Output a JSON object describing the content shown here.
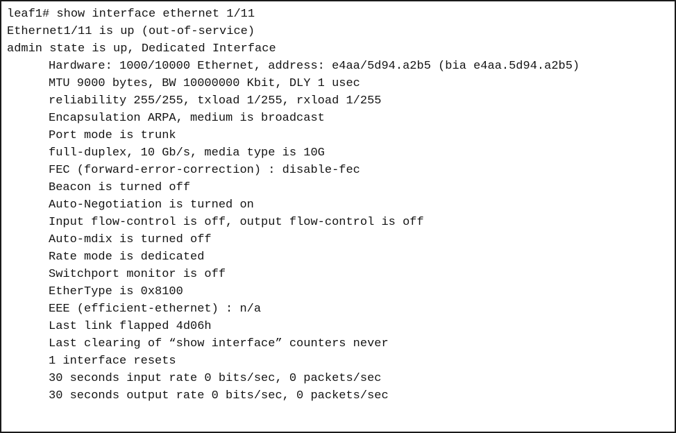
{
  "terminal": {
    "prompt_line": "leaf1# show interface ethernet 1/11",
    "command": "show interface ethernet 1/11",
    "hostname_prompt": "leaf1#",
    "interface": "Ethernet1/11",
    "colors": {
      "background": "#ffffff",
      "text": "#141414",
      "border": "#1a1a1a"
    },
    "lines": [
      {
        "text": "leaf1# show interface ethernet 1/11",
        "indent": false
      },
      {
        "text": "Ethernet1/11 is up (out-of-service)",
        "indent": false
      },
      {
        "text": "admin state is up, Dedicated Interface",
        "indent": false
      },
      {
        "text": "Hardware: 1000/10000 Ethernet, address: e4aa/5d94.a2b5 (bia e4aa.5d94.a2b5)",
        "indent": true
      },
      {
        "text": "MTU 9000 bytes, BW 10000000 Kbit, DLY 1 usec",
        "indent": true
      },
      {
        "text": "reliability 255/255, txload 1/255, rxload 1/255",
        "indent": true
      },
      {
        "text": "Encapsulation ARPA, medium is broadcast",
        "indent": true
      },
      {
        "text": "Port mode is trunk",
        "indent": true
      },
      {
        "text": "full-duplex, 10 Gb/s, media type is 10G",
        "indent": true
      },
      {
        "text": "FEC (forward-error-correction) : disable-fec",
        "indent": true
      },
      {
        "text": "Beacon is turned off",
        "indent": true
      },
      {
        "text": "Auto-Negotiation is turned on",
        "indent": true
      },
      {
        "text": "Input flow-control is off, output flow-control is off",
        "indent": true
      },
      {
        "text": "Auto-mdix is turned off",
        "indent": true
      },
      {
        "text": "Rate mode is dedicated",
        "indent": true
      },
      {
        "text": "Switchport monitor is off",
        "indent": true
      },
      {
        "text": "EtherType is 0x8100",
        "indent": true
      },
      {
        "text": "EEE (efficient-ethernet) : n/a",
        "indent": true
      },
      {
        "text": "Last link flapped 4d06h",
        "indent": true
      },
      {
        "text": "Last clearing of “show interface” counters never",
        "indent": true
      },
      {
        "text": "1 interface resets",
        "indent": true
      },
      {
        "text": "30 seconds input rate 0 bits/sec, 0 packets/sec",
        "indent": true
      },
      {
        "text": "30 seconds output rate 0 bits/sec, 0 packets/sec",
        "indent": true
      }
    ]
  }
}
